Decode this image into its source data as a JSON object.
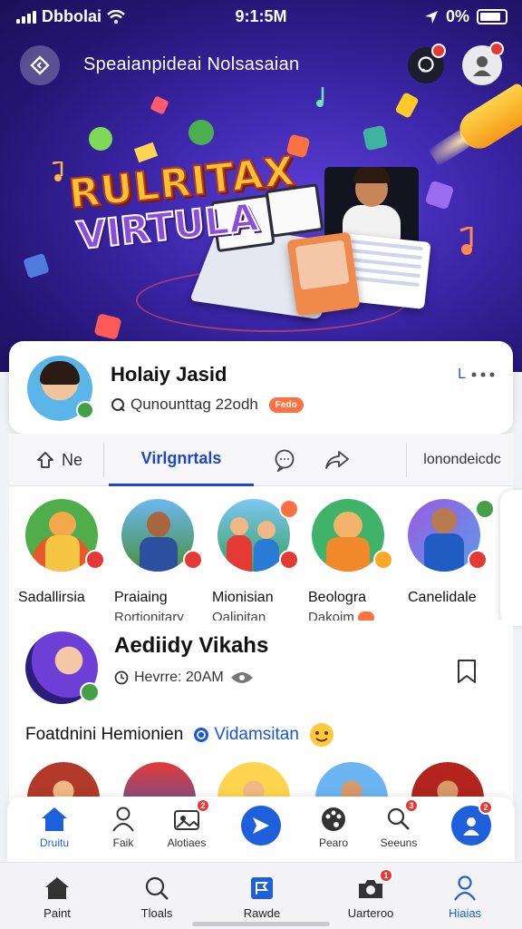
{
  "status_bar": {
    "carrier": "Dbbolai",
    "time": "9:1:5M",
    "battery": "0%"
  },
  "header": {
    "title": "Speaianpideai Nolsasaian"
  },
  "hero": {
    "logo_line1": "RULRITAX",
    "logo_line2": "VIRTULA"
  },
  "profile": {
    "name": "Holaiy Jasid",
    "subtitle": "Qunounttag 22odh",
    "tag": "Fedo",
    "more_label": "L"
  },
  "tabs": [
    {
      "label": "Ne"
    },
    {
      "label": "Virlgnrtals"
    },
    {
      "label": ""
    },
    {
      "label": ""
    },
    {
      "label": "lonondeicdc"
    }
  ],
  "stories": [
    {
      "name": "Sadallirsia",
      "sub": ""
    },
    {
      "name": "Praiaing",
      "sub": "Rortionitary"
    },
    {
      "name": "Mionisian",
      "sub": "Oalipitan"
    },
    {
      "name": "Beologra",
      "sub": "Dakoim"
    },
    {
      "name": "Canelidale",
      "sub": ""
    }
  ],
  "post": {
    "author": "Aediidy Vikahs",
    "time": "Hevrre: 20AM",
    "text_prefix": "Foatdnini Hemionien",
    "text_link": "Vidamsitan"
  },
  "action_bar": [
    {
      "label": "Druitu",
      "icon": "home-icon"
    },
    {
      "label": "Faik",
      "icon": "person-icon"
    },
    {
      "label": "Alotiaes",
      "icon": "album-icon",
      "badge": "2"
    },
    {
      "label": "",
      "icon": "send-icon"
    },
    {
      "label": "Pearo",
      "icon": "palette-icon"
    },
    {
      "label": "Seeuns",
      "icon": "search-people-icon",
      "badge": "3"
    },
    {
      "label": "",
      "icon": "profile-icon",
      "badge": "2"
    }
  ],
  "tab_bar": [
    {
      "label": "Paint",
      "icon": "home-icon"
    },
    {
      "label": "Tloals",
      "icon": "search-icon"
    },
    {
      "label": "Rawde",
      "icon": "flag-icon"
    },
    {
      "label": "Uarteroo",
      "icon": "camera-icon",
      "badge": "1"
    },
    {
      "label": "Hiaias",
      "icon": "person-icon"
    }
  ],
  "colors": {
    "hero_bg": "#3b26a8",
    "accent_blue": "#1e46c8",
    "badge_red": "#e53935",
    "check_green": "#43a047"
  }
}
